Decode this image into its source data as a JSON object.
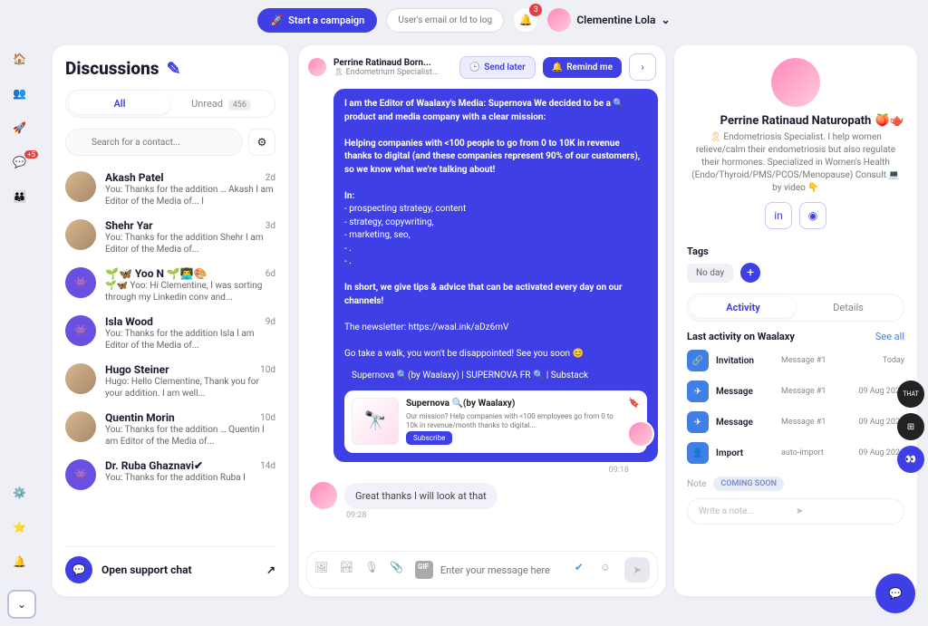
{
  "top": {
    "start_campaign": "Start a campaign",
    "search_placeholder": "User's email or Id to log",
    "notif_count": "3",
    "user_name": "Clementine Lola"
  },
  "leftnav": {
    "msg_badge": "+5"
  },
  "disc": {
    "title": "Discussions",
    "tab_all": "All",
    "tab_unread": "Unread",
    "unread_count": "456",
    "search_placeholder": "Search for a contact...",
    "support": "Open support chat",
    "items": [
      {
        "name": "Akash Patel",
        "time": "2d",
        "snip": "You: Thanks for the addition … Akash I am Editor of the Media of... I",
        "av": "photo1"
      },
      {
        "name": "Shehr Yar",
        "time": "3d",
        "snip": "You: Thanks for the addition Shehr I am Editor of the Media of...",
        "av": "photo2"
      },
      {
        "name": "🌱🦋 Yoo N 🌱👨‍💻🎨",
        "time": "6d",
        "snip": "🌱🦋 Yoo: Hi Clementine, I was sorting through my Linkedin conv and...",
        "av": "alien"
      },
      {
        "name": "Isla Wood",
        "time": "9d",
        "snip": "You: Thanks for the addition Isla I am Editor of the Media of...",
        "av": "alien"
      },
      {
        "name": "Hugo Steiner",
        "time": "10d",
        "snip": "Hugo: Hello Clementine, Thank you for your addition. I am well...",
        "av": "photo3"
      },
      {
        "name": "Quentin Morin",
        "time": "10d",
        "snip": "You: Thanks for the addition … Quentin I am Editor of the Media of...",
        "av": "photo4"
      },
      {
        "name": "Dr. Ruba Ghaznavi✔",
        "time": "14d",
        "snip": "You: Thanks for the addition Ruba I",
        "av": "alien"
      }
    ]
  },
  "chat": {
    "head_name": "Perrine Ratinaud Born...",
    "head_sub": "🎗 Endometrium Specialist...",
    "btn_later": "Send later",
    "btn_remind": "Remind me",
    "msg_lines": [
      "I am the Editor of Waalaxy's Media: Supernova We decided to be a 🔍 product and media company with a clear mission:",
      "",
      "Helping companies with <100 people to go from 0 to 10K in revenue thanks to digital (and these companies represent 90% of our customers), so we know what we're talking about!",
      "",
      "In:",
      "  - prospecting strategy, content",
      "  - strategy, copywriting,",
      "  - marketing, seo,",
      "  - .",
      "  - .",
      "",
      "In short, we give tips & advice that can be activated every day on our channels!",
      "",
      "The newsletter: https://waal.ink/aDz6mV",
      "",
      "Go take a walk, you won't be disappointed! See you soon       😊"
    ],
    "card_line": "Supernova 🔍(by Waalaxy) | SUPERNOVA FR 🔍 | Substack",
    "card_title": "Supernova 🔍(by Waalaxy)",
    "card_desc": "Our mission? Help companies with <100 employees go from 0 to 10k in revenue/month thanks to digital....",
    "card_btn": "Subscribe",
    "ts_out": "09:18",
    "reply": "Great thanks I will look at that",
    "ts_in": "09:28",
    "composer_placeholder": "Enter your message here"
  },
  "prof": {
    "name": "Perrine Ratinaud Naturopath",
    "emoji": "🍑🫖",
    "desc_prefix": "🎗 ",
    "desc": "Endometriosis Specialist. I help women relieve/calm their endometriosis but also regulate their hormones. Specialized in Women's Health (Endo/Thyroid/PMS/PCOS/Menopause) Consult 💻 by video      👇",
    "tags_title": "Tags",
    "tag1": "No day",
    "tab_activity": "Activity",
    "tab_details": "Details",
    "act_title": "Last activity on Waalaxy",
    "see_all": "See all",
    "note_label": "Note",
    "soon": "COMING SOON",
    "note_placeholder": "Write a note...",
    "rows": [
      {
        "ic": "link",
        "t": "Invitation",
        "m": "Message #1",
        "d": "Today"
      },
      {
        "ic": "send",
        "t": "Message",
        "m": "Message #1",
        "d": "09 Aug 2024"
      },
      {
        "ic": "send",
        "t": "Message",
        "m": "Message #1",
        "d": "09 Aug 2024"
      },
      {
        "ic": "user",
        "t": "Import",
        "m": "auto-import",
        "d": "09 Aug 2024"
      }
    ]
  },
  "dock": {
    "that": "THAT"
  }
}
